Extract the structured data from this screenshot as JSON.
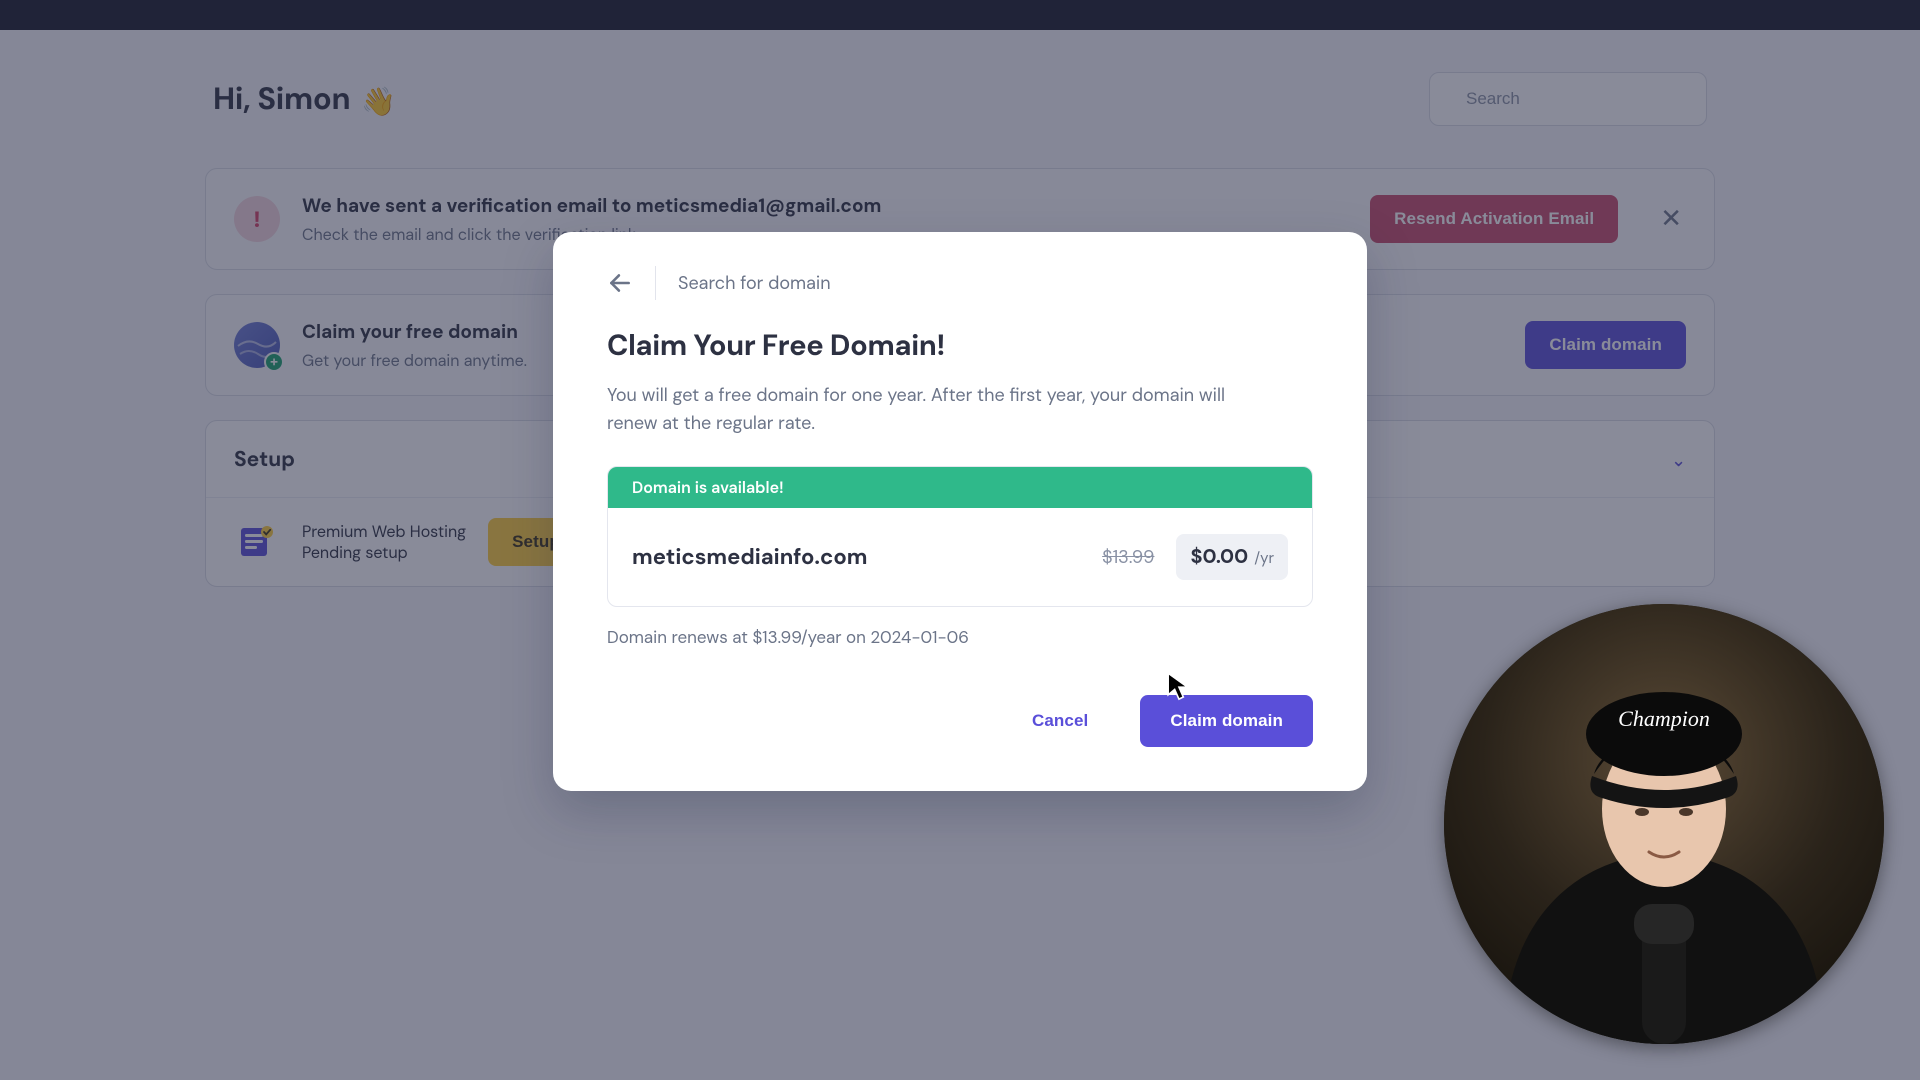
{
  "header": {
    "greeting_prefix": "Hi, ",
    "greeting_name": "Simon",
    "wave_emoji": "👋",
    "search_placeholder": "Search"
  },
  "verify_banner": {
    "title": "We have sent a verification email to meticsmedia1@gmail.com",
    "subtitle": "Check the email and click the verification link.",
    "button": "Resend Activation Email"
  },
  "claim_banner": {
    "title": "Claim your free domain",
    "subtitle": "Get your free domain anytime.",
    "button": "Claim domain"
  },
  "setup": {
    "heading": "Setup",
    "item_title": "Premium Web Hosting",
    "item_status": "Pending setup",
    "item_button": "Setup"
  },
  "modal": {
    "search_label": "Search for domain",
    "title": "Claim Your Free Domain!",
    "description": "You will get a free domain for one year. After the first year, your domain will renew at the regular rate.",
    "availability": "Domain is available!",
    "domain": "meticsmediainfo.com",
    "price_old": "$13.99",
    "price_new": "$0.00",
    "price_period": "/yr",
    "renew_note": "Domain renews at $13.99/year on 2024-01-06",
    "cancel": "Cancel",
    "confirm": "Claim domain"
  },
  "cam": {
    "brand": "Champion"
  }
}
